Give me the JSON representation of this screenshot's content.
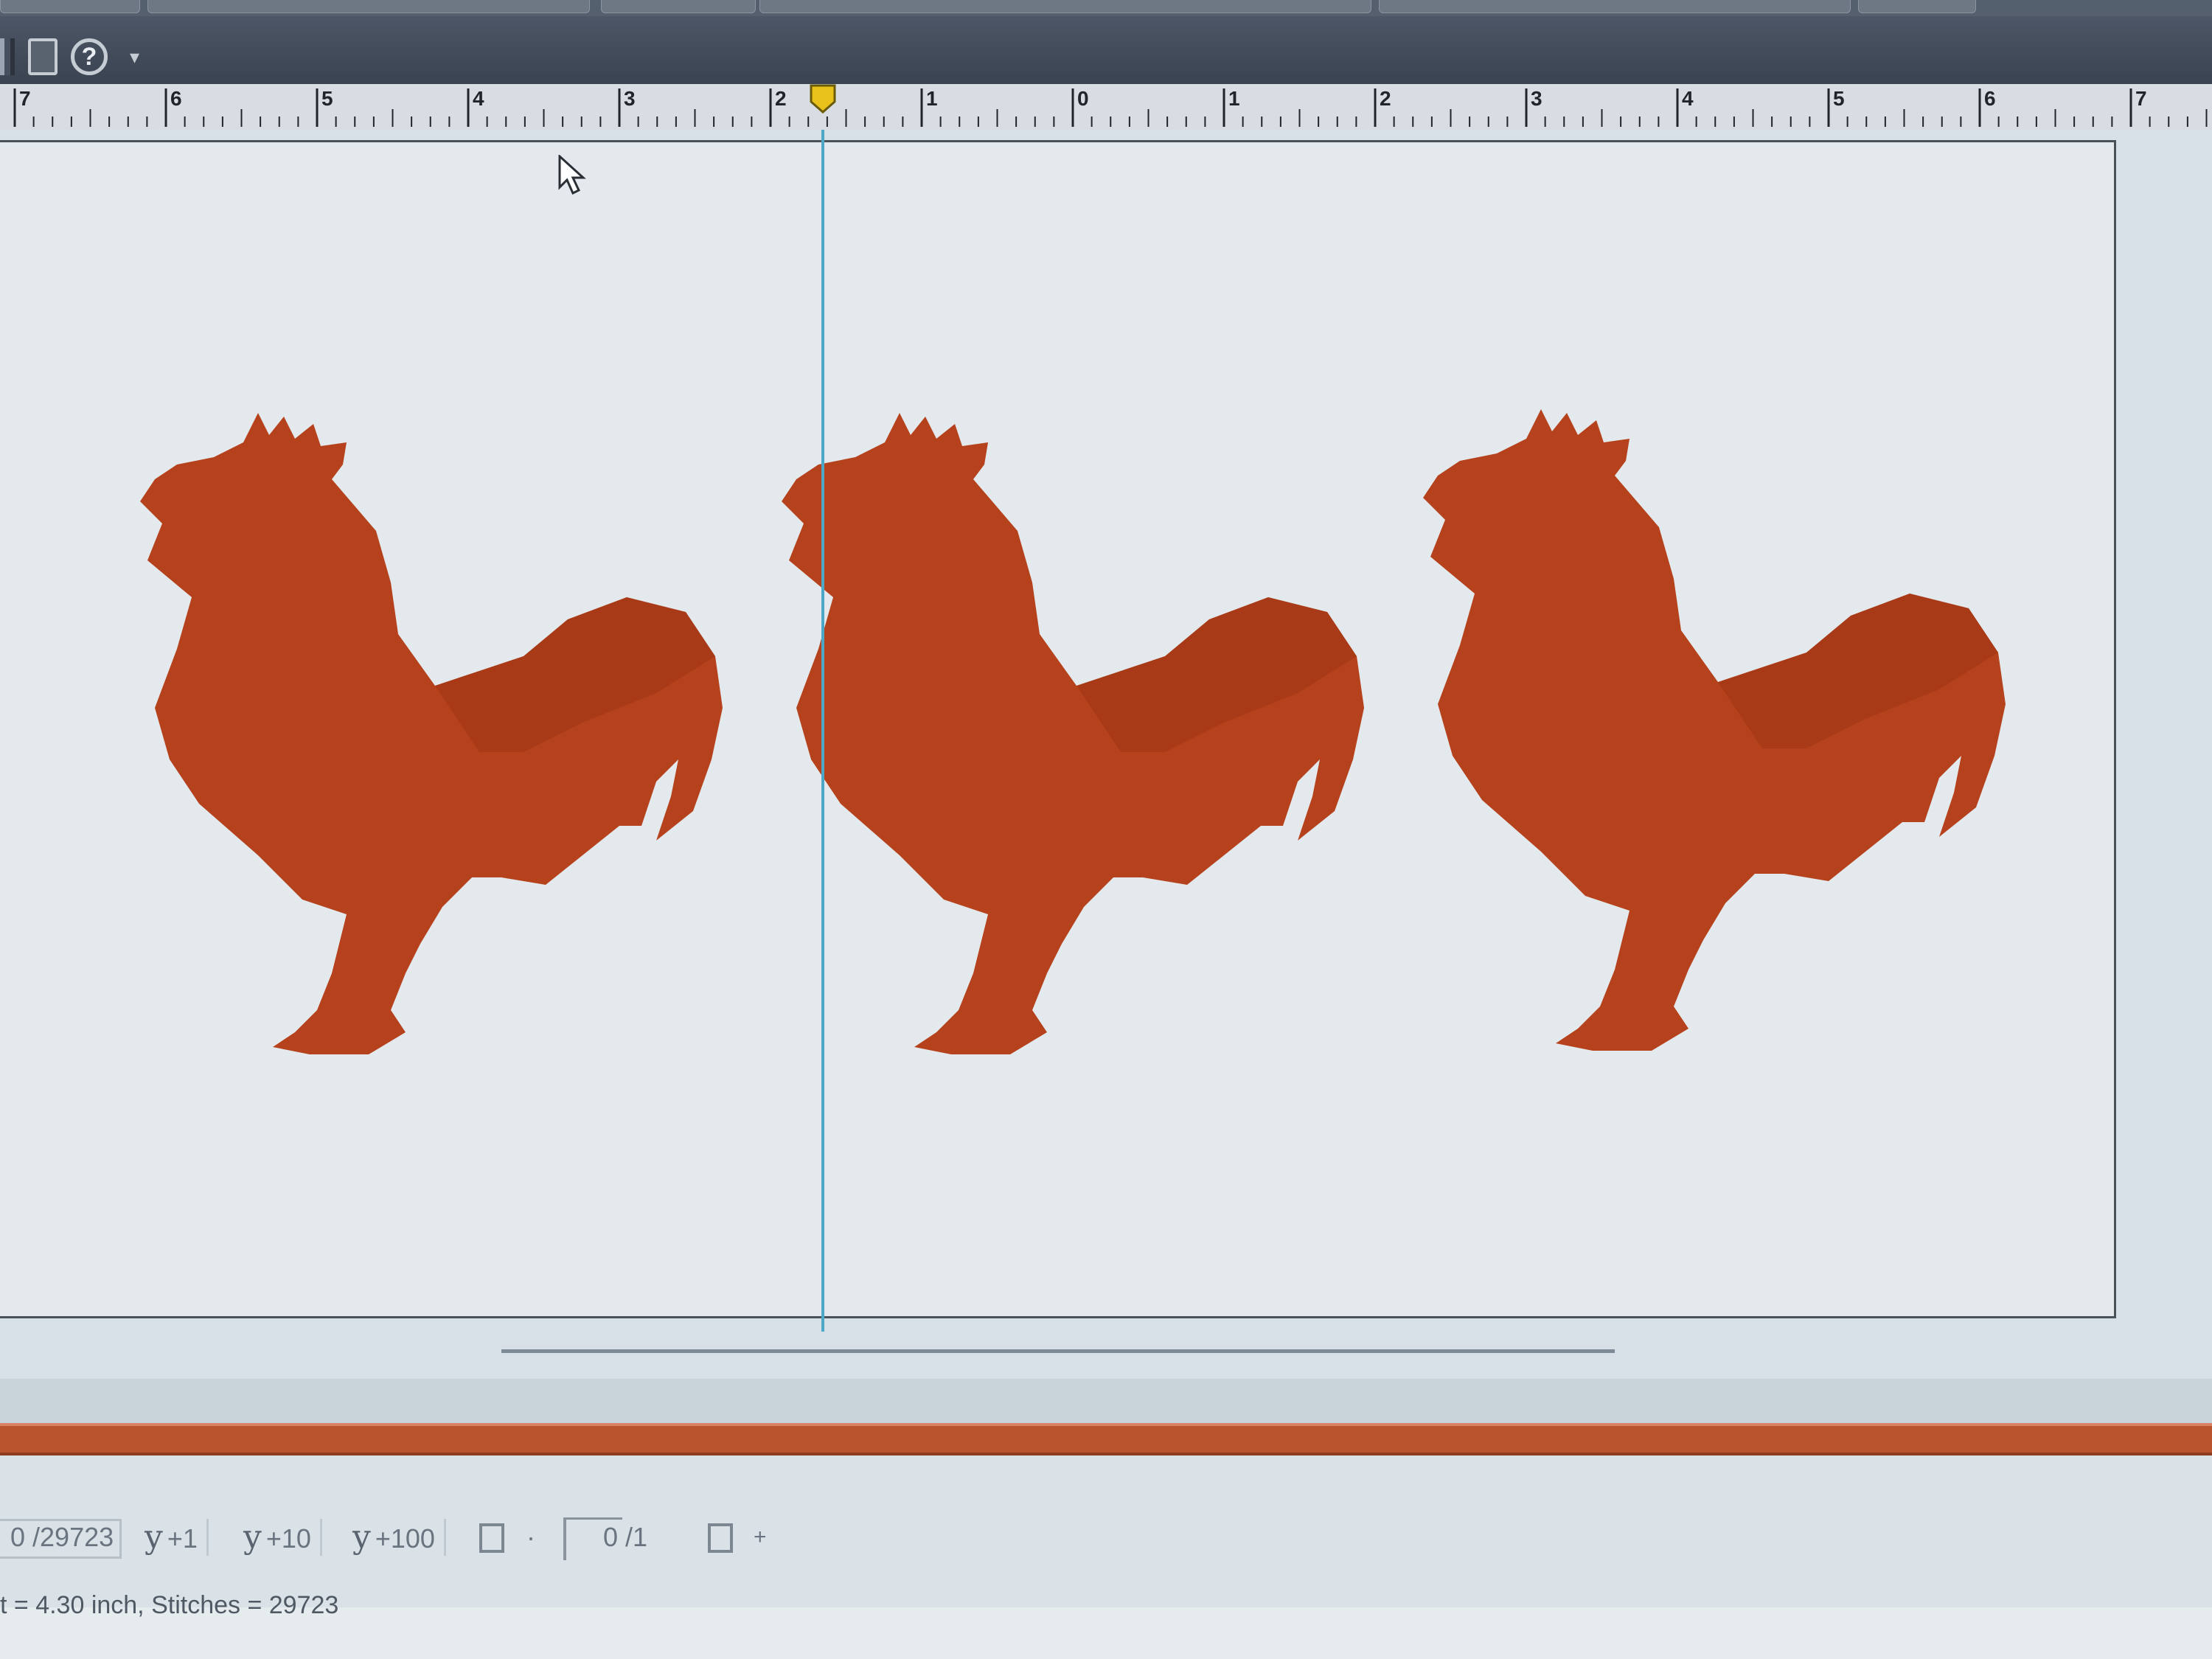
{
  "ruler": {
    "labels": [
      "7",
      "6",
      "5",
      "4",
      "3",
      "2",
      "1",
      "0",
      "1",
      "2",
      "3",
      "4",
      "5",
      "6",
      "7"
    ]
  },
  "toolbar": {
    "help_icon": "help-icon",
    "help_glyph": "?",
    "more_glyph": "▾"
  },
  "canvas": {
    "design_color": "#b5421c",
    "design_shade": "#8a2e12",
    "hoop_color": "#e3e9ec",
    "guide_color": "#4da8c8",
    "design_count": 3
  },
  "progress": {
    "color": "#b9542e",
    "fraction": 1.0
  },
  "controls": {
    "stitch_counter": "0 /29723",
    "step_1": "+1",
    "step_10": "+10",
    "step_100": "+100",
    "step_glyph": "y",
    "page_counter": "0 /1",
    "plus": "+",
    "dot": "·"
  },
  "status": {
    "text": "t = 4.30 inch, Stitches = 29723"
  }
}
